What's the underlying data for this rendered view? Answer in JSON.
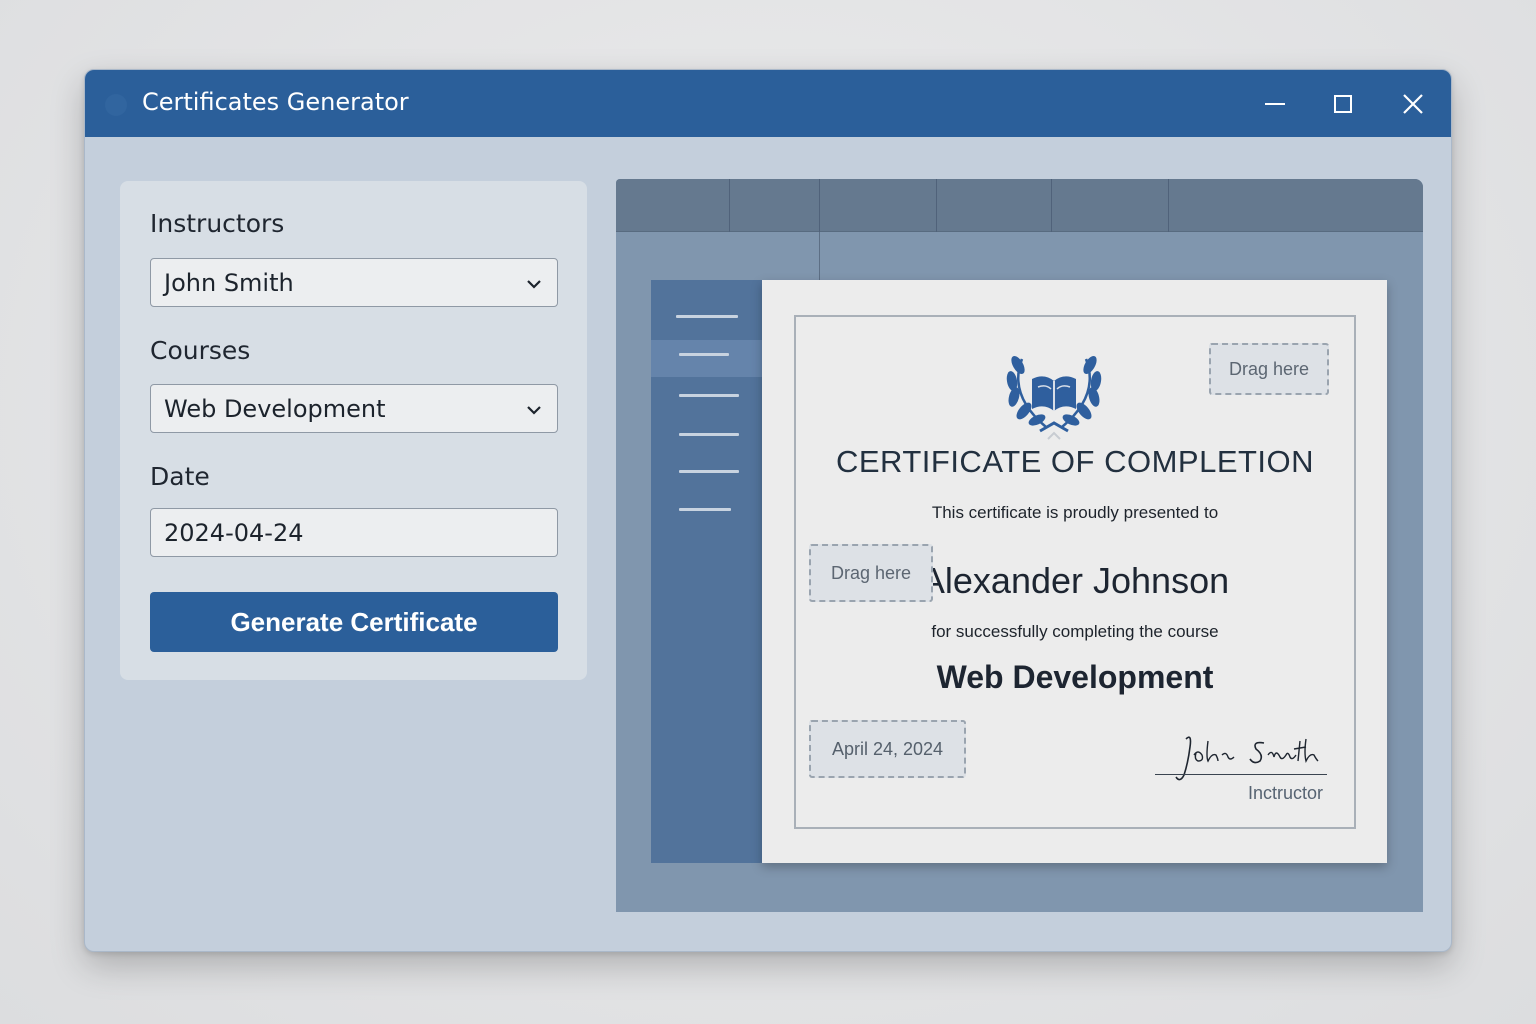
{
  "window": {
    "title": "Certificates Generator"
  },
  "form": {
    "instructors_label": "Instructors",
    "instructor_value": "John Smith",
    "courses_label": "Courses",
    "course_value": "Web Development",
    "date_label": "Date",
    "date_value": "2024-04-24",
    "generate_button": "Generate Certificate"
  },
  "certificate": {
    "heading": "CERTIFICATE OF COMPLETION",
    "presented_text": "This certificate is proudly presented to",
    "recipient": "Alexander Johnson",
    "completing_text": "for successfully completing the course",
    "course": "Web Development",
    "date": "April 24, 2024",
    "signature": "John Smith",
    "instructor_caption": "Inctructor",
    "drag_hint_top": "Drag here",
    "drag_hint_left": "Drag here"
  },
  "colors": {
    "accent": "#2b5f9a",
    "window_bg": "#c4cfdc",
    "emblem": "#2f5f9e"
  },
  "icons": {
    "close": "close-icon",
    "maximize": "maximize-icon",
    "minimize": "minimize-icon",
    "dropdown": "chevron-down-icon",
    "emblem": "laurel-book-icon"
  }
}
